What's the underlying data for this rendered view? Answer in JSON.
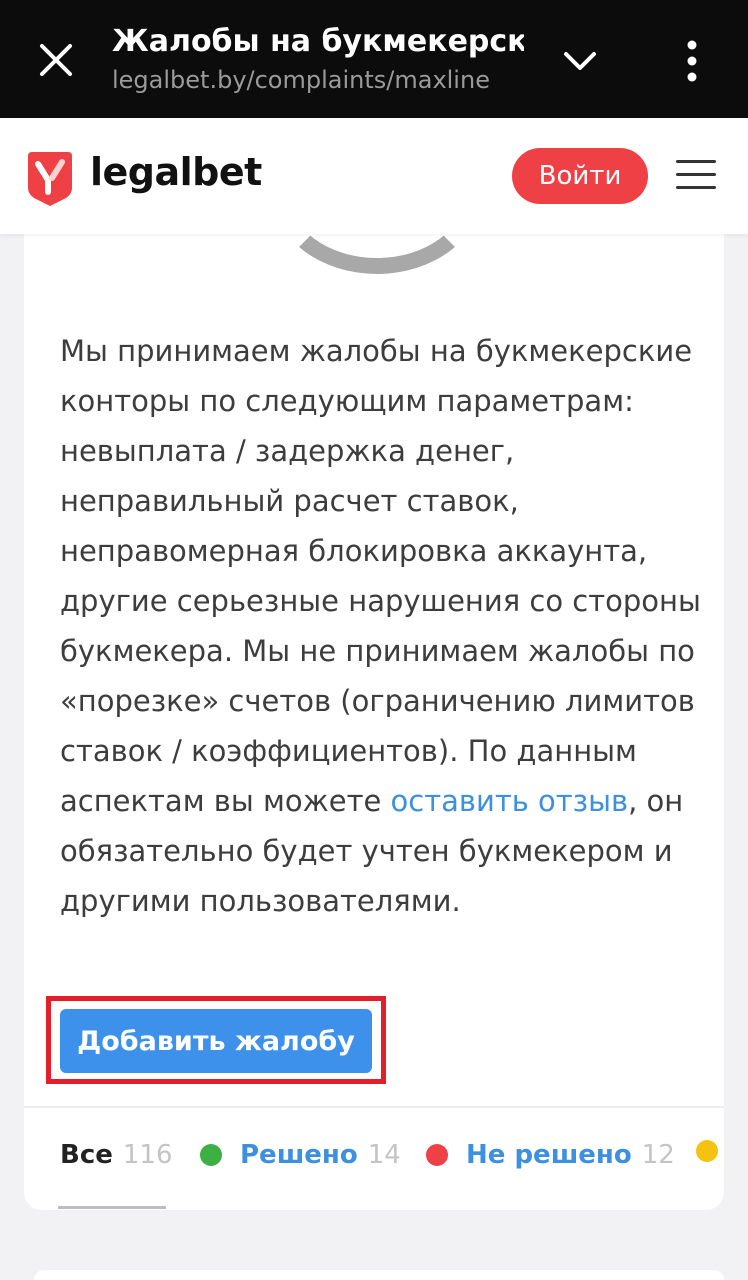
{
  "browser": {
    "title": "Жалобы на букмекерскую",
    "url": "legalbet.by/complaints/maxline"
  },
  "header": {
    "logo_text": "legalbet",
    "login_label": "Войти"
  },
  "content": {
    "description_before": "Мы принимаем жалобы на букмекерские конторы по следующим параметрам: невыплата / задержка денег, неправильный расчет ставок, неправомерная блокировка аккаунта, другие серьезные нарушения со стороны букмекера. Мы не принимаем жалобы по «порезке» счетов (ограничению лимитов ставок / коэффициентов). По данным аспектам вы можете ",
    "review_link": "оставить отзыв",
    "description_after": ", он обязательно будет учтен букмекером и другими пользователями.",
    "add_complaint_label": "Добавить жалобу"
  },
  "filters": {
    "all": {
      "label": "Все",
      "count": "116"
    },
    "solved": {
      "label": "Решено",
      "count": "14",
      "color": "#3cb043"
    },
    "unsolved": {
      "label": "Не решено",
      "count": "12",
      "color": "#ee4045"
    },
    "pending": {
      "color": "#f5c20f"
    }
  },
  "colors": {
    "accent_red": "#ee4045",
    "primary_blue": "#3e91ea",
    "link_blue": "#3d8fe0",
    "highlight_border": "#e41f2b"
  }
}
